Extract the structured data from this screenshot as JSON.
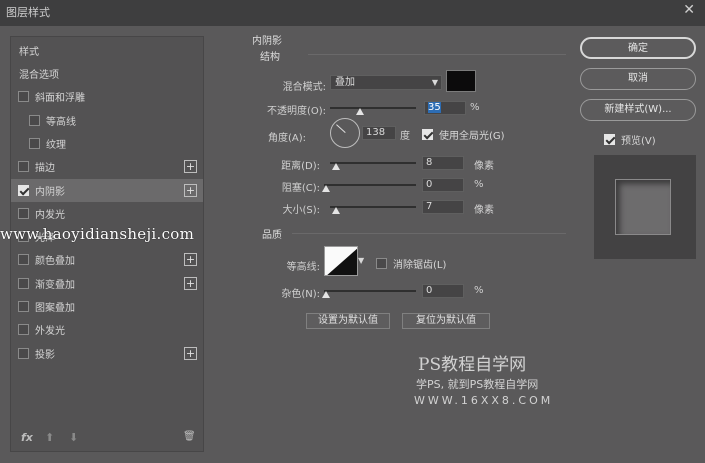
{
  "window": {
    "title": "图层样式",
    "close_glyph": "✕"
  },
  "sidebar": {
    "header": "样式",
    "items": [
      {
        "label": "混合选项",
        "checkbox": false,
        "checked": false,
        "plus": false,
        "indent": 0
      },
      {
        "label": "斜面和浮雕",
        "checkbox": true,
        "checked": false,
        "plus": false,
        "indent": 0
      },
      {
        "label": "等高线",
        "checkbox": true,
        "checked": false,
        "plus": false,
        "indent": 1
      },
      {
        "label": "纹理",
        "checkbox": true,
        "checked": false,
        "plus": false,
        "indent": 1
      },
      {
        "label": "描边",
        "checkbox": true,
        "checked": false,
        "plus": true,
        "indent": 0
      },
      {
        "label": "内阴影",
        "checkbox": true,
        "checked": true,
        "plus": true,
        "indent": 0,
        "selected": true
      },
      {
        "label": "内发光",
        "checkbox": true,
        "checked": false,
        "plus": false,
        "indent": 0
      },
      {
        "label": "光泽",
        "checkbox": true,
        "checked": false,
        "plus": false,
        "indent": 0
      },
      {
        "label": "颜色叠加",
        "checkbox": true,
        "checked": false,
        "plus": true,
        "indent": 0
      },
      {
        "label": "渐变叠加",
        "checkbox": true,
        "checked": false,
        "plus": true,
        "indent": 0
      },
      {
        "label": "图案叠加",
        "checkbox": true,
        "checked": false,
        "plus": false,
        "indent": 0
      },
      {
        "label": "外发光",
        "checkbox": true,
        "checked": false,
        "plus": false,
        "indent": 0
      },
      {
        "label": "投影",
        "checkbox": true,
        "checked": false,
        "plus": true,
        "indent": 0
      }
    ],
    "footer": {
      "fx": "fx",
      "up": "⬆",
      "down": "⬇",
      "trash": "🗑"
    }
  },
  "panel": {
    "title": "内阴影",
    "structure_title": "结构",
    "blend_mode_label": "混合模式:",
    "blend_mode_value": "叠加",
    "shadow_color": "#0c0b0c",
    "opacity_label": "不透明度(O):",
    "opacity_value": "35",
    "opacity_fraction": 0.35,
    "angle_label": "角度(A):",
    "angle_value": "138",
    "angle_unit": "度",
    "use_global_light_label": "使用全局光(G)",
    "use_global_light_checked": true,
    "distance_label": "距离(D):",
    "distance_value": "8",
    "choke_label": "阻塞(C):",
    "choke_value": "0",
    "size_label": "大小(S):",
    "size_value": "7",
    "px_unit": "像素",
    "percent_unit": "%",
    "quality_title": "品质",
    "contour_label": "等高线:",
    "anti_alias_label": "消除锯齿(L)",
    "anti_alias_checked": false,
    "noise_label": "杂色(N):",
    "noise_value": "0",
    "set_default_label": "设置为默认值",
    "reset_default_label": "复位为默认值"
  },
  "actions": {
    "ok_label": "确定",
    "cancel_label": "取消",
    "new_style_label": "新建样式(W)...",
    "preview_label": "预览(V)",
    "preview_checked": true
  },
  "watermarks": {
    "url": "www.haoyidiansheji.com",
    "ps_title": "PS教程自学网",
    "ps_sub": "学PS, 就到PS教程自学网",
    "ps_site": "WWW.16XX8.COM"
  }
}
